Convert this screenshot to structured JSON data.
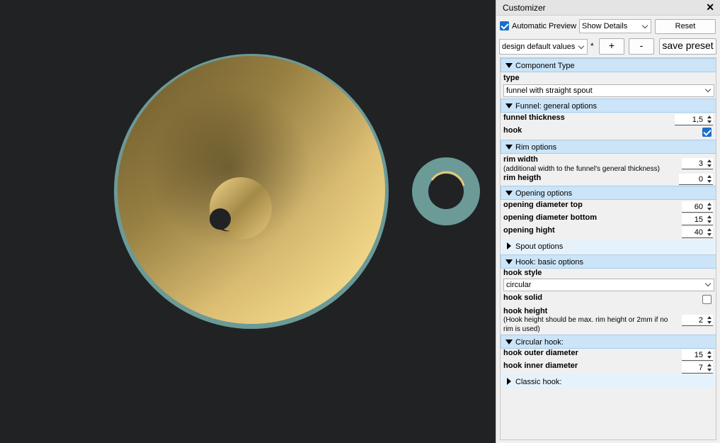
{
  "panel": {
    "title": "Customizer",
    "auto_preview_label": "Automatic Preview",
    "auto_preview_checked": true,
    "details_select": "Show Details",
    "reset_label": "Reset",
    "preset_select": "design default values",
    "preset_modified_marker": "*",
    "add_preset_label": "+",
    "remove_preset_label": "-",
    "save_preset_label": "save preset"
  },
  "sections": {
    "component_type": "Component Type",
    "funnel_general": "Funnel: general options",
    "rim_options": "Rim options",
    "opening_options": "Opening options",
    "spout_options": "Spout options",
    "hook_basic": "Hook: basic options",
    "circular_hook": "Circular hook:",
    "classic_hook": "Classic hook:"
  },
  "params": {
    "type": {
      "label": "type",
      "value": "funnel with straight spout"
    },
    "funnel_thickness": {
      "label": "funnel thickness",
      "value": "1,5"
    },
    "hook": {
      "label": "hook",
      "checked": true
    },
    "rim_width": {
      "label": "rim width",
      "description": "(additional width to the funnel's general thickness)",
      "value": "3"
    },
    "rim_height": {
      "label": "rim heigth",
      "value": "0"
    },
    "opening_top": {
      "label": "opening diameter top",
      "value": "60"
    },
    "opening_bottom": {
      "label": "opening diameter bottom",
      "value": "15"
    },
    "opening_hight": {
      "label": "opening hight",
      "value": "40"
    },
    "hook_style": {
      "label": "hook style",
      "value": "circular"
    },
    "hook_solid": {
      "label": "hook solid",
      "checked": false
    },
    "hook_height": {
      "label": "hook height",
      "description_1": "(Hook height should be max. rim height or 2mm if no",
      "description_2": "rim is used)",
      "value": "2"
    },
    "hook_outer": {
      "label": "hook outer diameter",
      "value": "15"
    },
    "hook_inner": {
      "label": "hook inner diameter",
      "value": "7"
    }
  },
  "viewport": {
    "background": "#202224",
    "rim_color": "#6b9a97",
    "funnel_color": "#e2c27a"
  }
}
